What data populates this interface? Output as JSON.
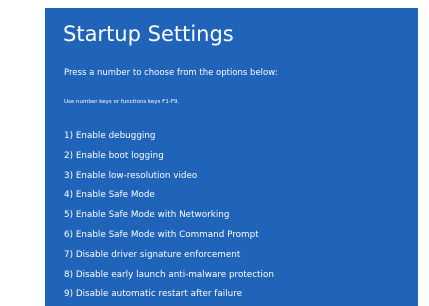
{
  "screen": {
    "background_color": "#1f64b9",
    "text_color": "#ffffff",
    "title": "Startup Settings",
    "prompt": "Press a number to choose from the options below:",
    "hint": "Use number keys or functions keys F1-F9.",
    "options": [
      {
        "label": "1) Enable debugging"
      },
      {
        "label": "2) Enable boot logging"
      },
      {
        "label": "3) Enable low-resolution video"
      },
      {
        "label": "4) Enable Safe Mode"
      },
      {
        "label": "5) Enable Safe Mode with Networking"
      },
      {
        "label": "6) Enable Safe Mode with Command Prompt"
      },
      {
        "label": "7) Disable driver signature enforcement"
      },
      {
        "label": "8) Disable early launch anti-malware protection"
      },
      {
        "label": "9) Disable automatic restart after failure"
      }
    ]
  }
}
